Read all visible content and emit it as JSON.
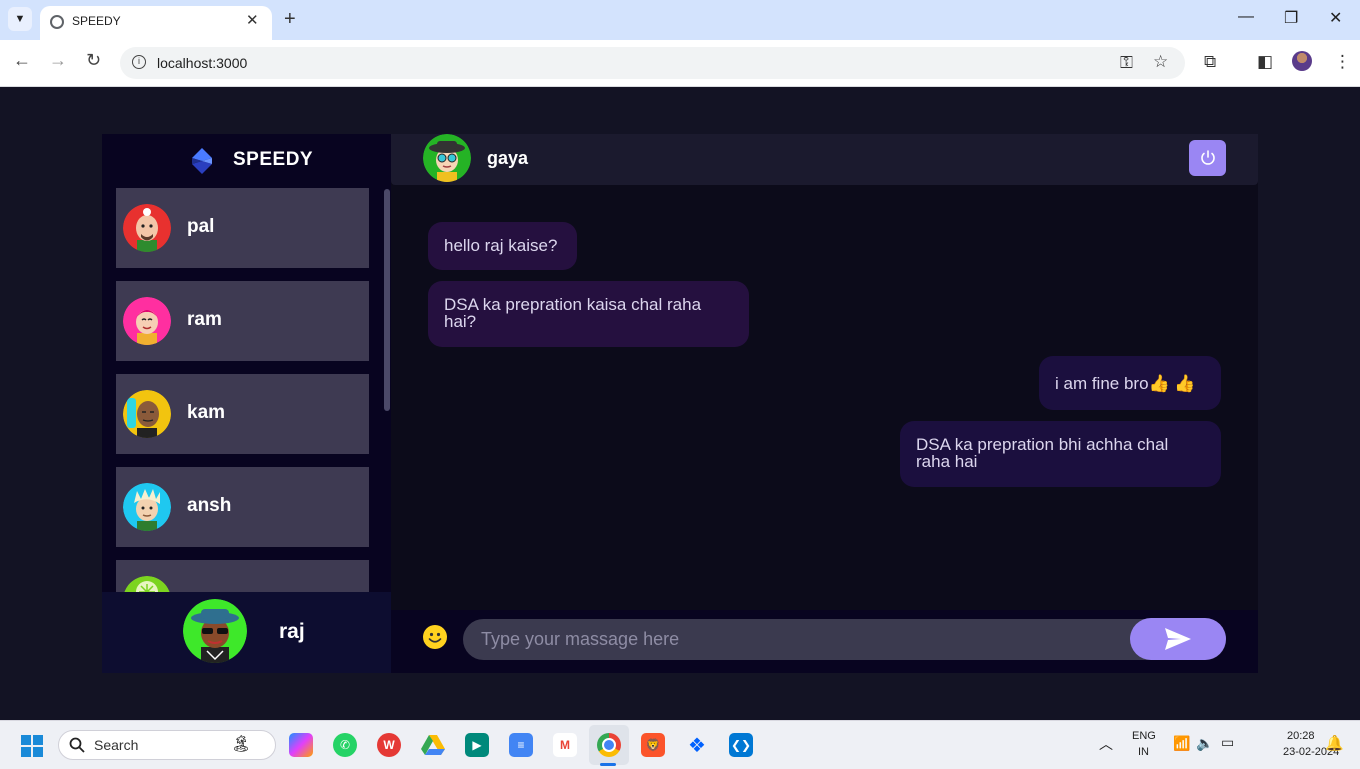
{
  "browser": {
    "tab_title": "SPEEDY",
    "url": "localhost:3000"
  },
  "app": {
    "brand": "SPEEDY",
    "contacts": [
      {
        "name": "pal"
      },
      {
        "name": "ram"
      },
      {
        "name": "kam"
      },
      {
        "name": "ansh"
      },
      {
        "name": ""
      }
    ],
    "current_user": "raj",
    "chat": {
      "contact_name": "gaya",
      "messages": [
        {
          "text": "hello raj kaise?",
          "direction": "incoming"
        },
        {
          "text": "DSA ka prepration kaisa chal raha hai?",
          "direction": "incoming"
        },
        {
          "text": "i am fine bro👍 👍",
          "direction": "outgoing"
        },
        {
          "text": "DSA ka prepration bhi achha chal raha hai",
          "direction": "outgoing"
        }
      ],
      "input_placeholder": "Type your massage here"
    },
    "colors": {
      "accent": "#9a86f3",
      "bubble_in": "#25103f",
      "bubble_out": "#1b0f3e"
    }
  },
  "taskbar": {
    "search_label": "Search",
    "lang_line1": "ENG",
    "lang_line2": "IN",
    "time": "20:28",
    "date": "23-02-2024"
  }
}
